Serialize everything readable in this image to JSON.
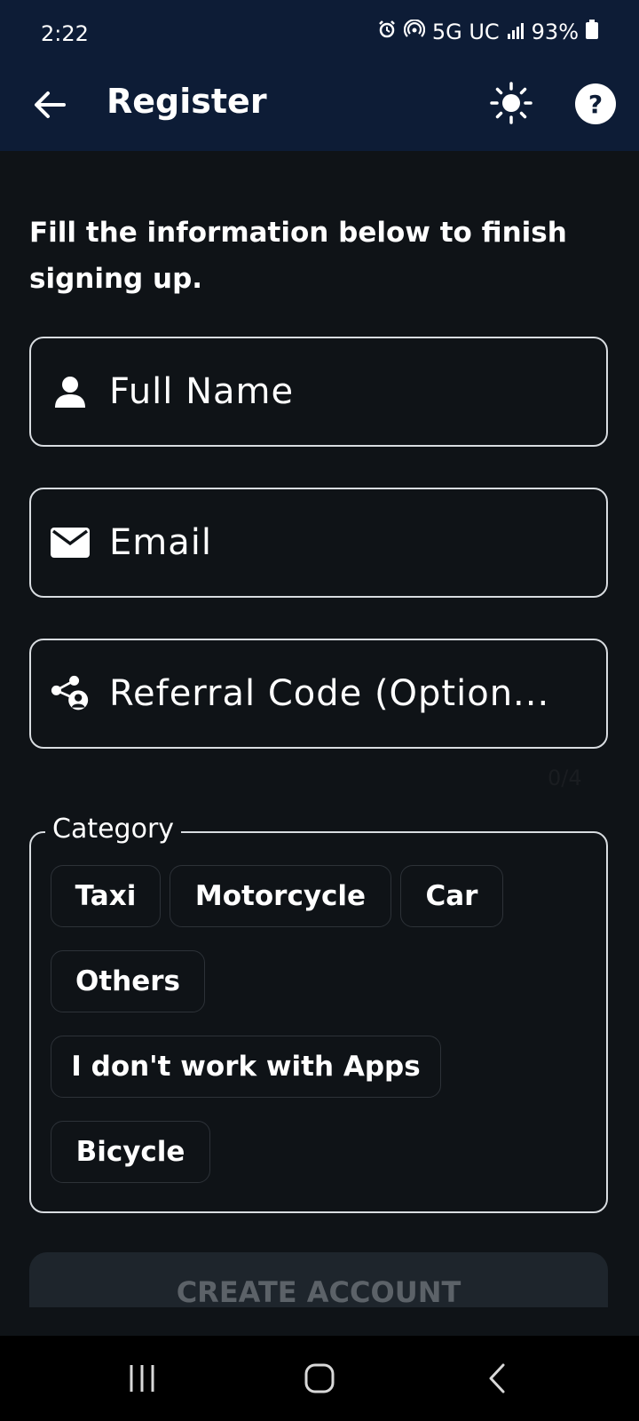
{
  "status_bar": {
    "time": "2:22",
    "network": "5G UC",
    "battery": "93%",
    "icons": [
      "alarm-icon",
      "hotspot-icon",
      "signal-icon",
      "battery-icon"
    ]
  },
  "app_bar": {
    "title": "Register",
    "help_glyph": "?",
    "icons": [
      "back-arrow-icon",
      "sun-icon",
      "help-icon"
    ]
  },
  "form": {
    "intro": "Fill the information below to finish signing up.",
    "full_name_placeholder": "Full Name",
    "email_placeholder": "Email",
    "referral_placeholder": "Referral Code (Option...",
    "referral_counter": "0/4"
  },
  "category": {
    "legend": "Category",
    "chips": [
      {
        "label": "Taxi"
      },
      {
        "label": "Motorcycle"
      },
      {
        "label": "Car"
      },
      {
        "label": "Others"
      },
      {
        "label": "I don't work with Apps"
      },
      {
        "label": "Bicycle"
      }
    ]
  },
  "actions": {
    "create_account_label": "CREATE ACCOUNT"
  },
  "nav_bar": {
    "icons": [
      "recents-icon",
      "home-icon",
      "back-icon"
    ]
  },
  "colors": {
    "header_bg": "#0d1c36",
    "page_bg": "#0f1317",
    "border": "#d8dce0",
    "button_disabled_bg": "#1e252c",
    "button_disabled_text": "#5c6268"
  }
}
